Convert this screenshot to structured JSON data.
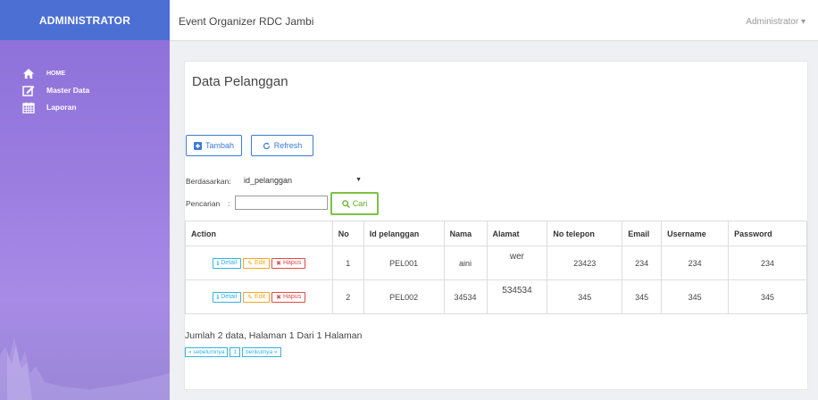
{
  "sidebar": {
    "brand": "ADMINISTRATOR",
    "items": [
      {
        "label": "HOME",
        "icon": "home-icon"
      },
      {
        "label": "Master Data",
        "icon": "edit-icon"
      },
      {
        "label": "Laporan",
        "icon": "calendar-icon"
      }
    ]
  },
  "topbar": {
    "title": "Event Organizer RDC Jambi",
    "user": "Administrator ▾"
  },
  "panel": {
    "title": "Data Pelanggan",
    "tambah_label": "Tambah",
    "refresh_label": "Refresh",
    "berdasarkan_label": "Berdasarkan:",
    "berdasarkan_value": "id_pelanggan",
    "pencarian_label": "Pencarian",
    "pencarian_sep": ":",
    "search_value": "",
    "cari_label": "Cari"
  },
  "table": {
    "headers": [
      "Action",
      "No",
      "Id pelanggan",
      "Nama",
      "Alamat",
      "No telepon",
      "Email",
      "Username",
      "Password"
    ],
    "action_labels": {
      "detail": "Detail",
      "edit": "Edit",
      "hapus": "Hapus"
    },
    "rows": [
      {
        "no": "1",
        "id": "PEL001",
        "nama": "aini",
        "alamat": "wer",
        "telepon": "23423",
        "email": "234",
        "username": "234",
        "password": "234"
      },
      {
        "no": "2",
        "id": "PEL002",
        "nama": "34534",
        "alamat": "534534",
        "telepon": "345",
        "email": "345",
        "username": "345",
        "password": "345"
      }
    ]
  },
  "summary": "Jumlah 2 data, Halaman 1 Dari 1 Halaman",
  "pager": {
    "prev": "« sebelumnya",
    "current": "1",
    "next": "berikutnya »"
  },
  "colors": {
    "brand_bar": "#4c6fd4",
    "sidebar": "#9b7de0",
    "primary": "#3a7bd5",
    "success": "#7cc244",
    "info": "#32b4e0",
    "warning": "#f5a623",
    "danger": "#e24a4a"
  }
}
